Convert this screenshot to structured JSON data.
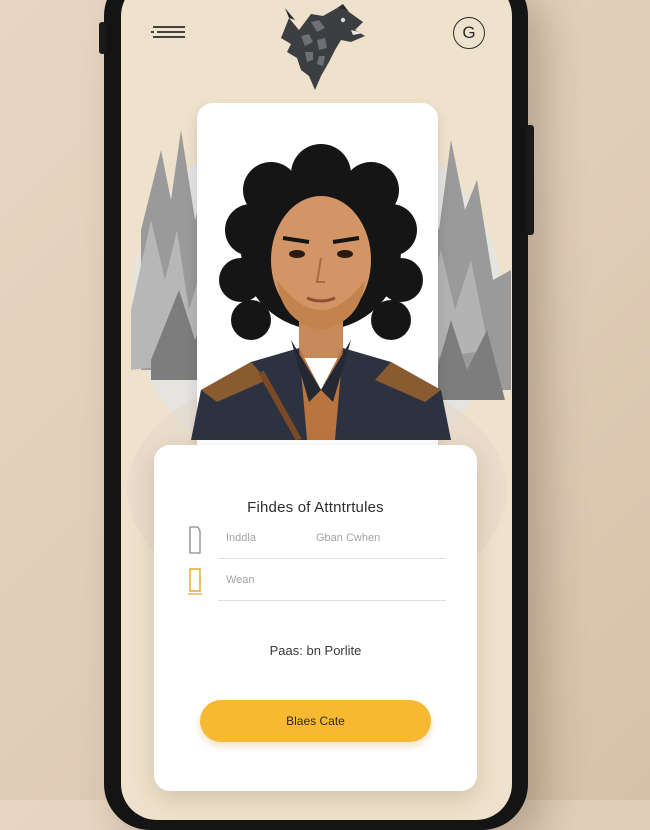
{
  "header": {
    "menu_icon": "hamburger-menu-icon",
    "logo_icon": "wolf-sigil-icon",
    "profile_letter": "G"
  },
  "form": {
    "title": "Fihdes of Attntrtules",
    "fields": [
      {
        "icon": "document-icon",
        "label": "Inddla",
        "value": "Gban Cwhen"
      },
      {
        "icon": "id-card-icon",
        "label": "Wean",
        "value": ""
      }
    ],
    "link_text": "Paas: bn Porlite",
    "cta_label": "Blaes Cate"
  },
  "colors": {
    "background": "#e4d3bf",
    "screen": "#efe2cc",
    "accent": "#f7b932",
    "field_icon_accent": "#e3a22c"
  }
}
